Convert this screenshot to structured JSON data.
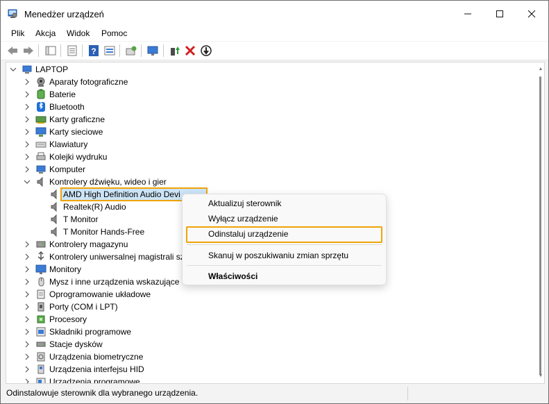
{
  "window": {
    "title": "Menedżer urządzeń",
    "controls": [
      "minimize-icon",
      "maximize-icon",
      "close-icon"
    ]
  },
  "menu": [
    "Plik",
    "Akcja",
    "Widok",
    "Pomoc"
  ],
  "toolbar": {
    "buttons": [
      "back-icon",
      "forward-icon",
      "properties-panel-icon",
      "list-view-icon",
      "help-icon",
      "device-view-icon",
      "scan-hardware-icon",
      "monitor-icon",
      "update-driver-icon",
      "uninstall-icon",
      "disable-icon"
    ]
  },
  "tree": {
    "root": "LAPTOP",
    "categories": [
      "Aparaty fotograficzne",
      "Baterie",
      "Bluetooth",
      "Karty graficzne",
      "Karty sieciowe",
      "Klawiatury",
      "Kolejki wydruku",
      "Komputer",
      "Kontrolery dźwięku, wideo i gier",
      "Kontrolery magazynu",
      "Kontrolery uniwersalnej magistrali sz",
      "Monitory",
      "Mysz i inne urządzenia wskazujące",
      "Oprogramowanie układowe",
      "Porty (COM i LPT)",
      "Procesory",
      "Składniki programowe",
      "Stacje dysków",
      "Urządzenia biometryczne",
      "Urządzenia interfejsu HID",
      "Urządzenia programowe"
    ],
    "audio_devices": [
      "AMD High Definition Audio Devi",
      "Realtek(R) Audio",
      "T Monitor",
      "T Monitor Hands-Free"
    ]
  },
  "context_menu": {
    "update_driver": "Aktualizuj sterownik",
    "disable_device": "Wyłącz urządzenie",
    "uninstall_device": "Odinstaluj urządzenie",
    "scan_changes": "Skanuj w poszukiwaniu zmian sprzętu",
    "properties": "Właściwości"
  },
  "status": "Odinstalowuje sterownik dla wybranego urządzenia.",
  "colors": {
    "highlight": "#f0a30a",
    "selection": "#cce4f7"
  }
}
